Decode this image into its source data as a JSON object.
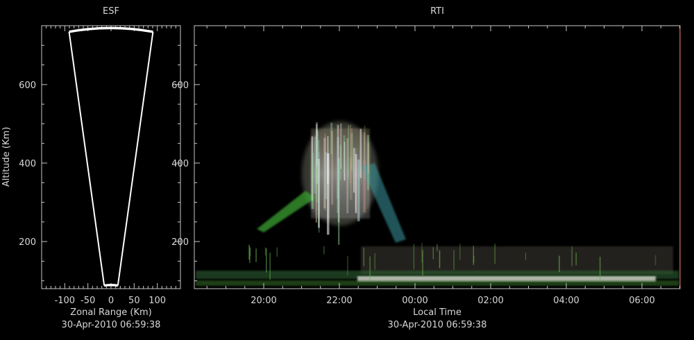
{
  "colors": {
    "background": "#000000",
    "axis": "#c8c8c8",
    "fan": "#ffffff",
    "rti_right_border": "#b03030"
  },
  "esf": {
    "title": "ESF",
    "ylabel": "Altitude (Km)",
    "xlabel": "Zonal Range (Km)",
    "timestamp": "30-Apr-2010 06:59:38"
  },
  "rti": {
    "title": "RTI",
    "xlabel": "Local Time",
    "timestamp": "30-Apr-2010 06:59:38"
  },
  "chart_data": [
    {
      "type": "scatter",
      "title": "ESF",
      "xlabel": "Zonal Range (Km)",
      "ylabel": "Altitude (Km)",
      "xlim": [
        -150,
        150
      ],
      "ylim": [
        80,
        750
      ],
      "xticks": [
        -100,
        -50,
        0,
        50,
        100
      ],
      "xtick_labels": [
        "-100",
        "-50",
        "0",
        "50",
        "100"
      ],
      "yticks": [
        200,
        400,
        600
      ],
      "ytick_labels": [
        "200",
        "400",
        "600"
      ],
      "fan": {
        "top_altitude": 745,
        "bottom_altitude": 88,
        "half_angle_deg": 10
      }
    },
    {
      "type": "heatmap",
      "title": "RTI",
      "xlabel": "Local Time",
      "ylabel": "Altitude (Km)",
      "x_ticks": [
        "20:00",
        "22:00",
        "00:00",
        "02:00",
        "04:00",
        "06:00"
      ],
      "ylim": [
        80,
        750
      ],
      "yticks": [
        200,
        400,
        600
      ]
    }
  ]
}
